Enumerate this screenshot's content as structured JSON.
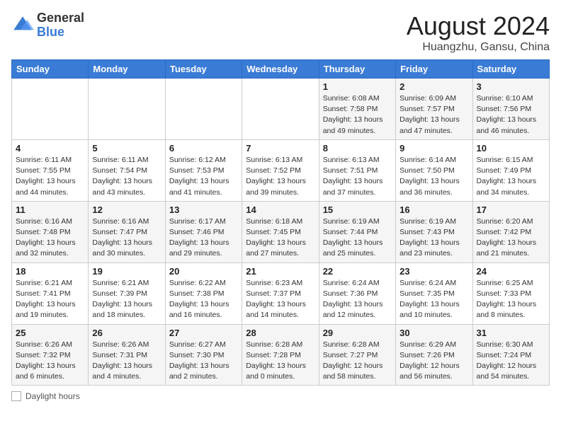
{
  "logo": {
    "general": "General",
    "blue": "Blue"
  },
  "title": {
    "month_year": "August 2024",
    "location": "Huangzhu, Gansu, China"
  },
  "weekdays": [
    "Sunday",
    "Monday",
    "Tuesday",
    "Wednesday",
    "Thursday",
    "Friday",
    "Saturday"
  ],
  "weeks": [
    [
      {
        "day": "",
        "info": ""
      },
      {
        "day": "",
        "info": ""
      },
      {
        "day": "",
        "info": ""
      },
      {
        "day": "",
        "info": ""
      },
      {
        "day": "1",
        "sunrise": "6:08 AM",
        "sunset": "7:58 PM",
        "daylight": "13 hours and 49 minutes."
      },
      {
        "day": "2",
        "sunrise": "6:09 AM",
        "sunset": "7:57 PM",
        "daylight": "13 hours and 47 minutes."
      },
      {
        "day": "3",
        "sunrise": "6:10 AM",
        "sunset": "7:56 PM",
        "daylight": "13 hours and 46 minutes."
      }
    ],
    [
      {
        "day": "4",
        "sunrise": "6:11 AM",
        "sunset": "7:55 PM",
        "daylight": "13 hours and 44 minutes."
      },
      {
        "day": "5",
        "sunrise": "6:11 AM",
        "sunset": "7:54 PM",
        "daylight": "13 hours and 43 minutes."
      },
      {
        "day": "6",
        "sunrise": "6:12 AM",
        "sunset": "7:53 PM",
        "daylight": "13 hours and 41 minutes."
      },
      {
        "day": "7",
        "sunrise": "6:13 AM",
        "sunset": "7:52 PM",
        "daylight": "13 hours and 39 minutes."
      },
      {
        "day": "8",
        "sunrise": "6:13 AM",
        "sunset": "7:51 PM",
        "daylight": "13 hours and 37 minutes."
      },
      {
        "day": "9",
        "sunrise": "6:14 AM",
        "sunset": "7:50 PM",
        "daylight": "13 hours and 36 minutes."
      },
      {
        "day": "10",
        "sunrise": "6:15 AM",
        "sunset": "7:49 PM",
        "daylight": "13 hours and 34 minutes."
      }
    ],
    [
      {
        "day": "11",
        "sunrise": "6:16 AM",
        "sunset": "7:48 PM",
        "daylight": "13 hours and 32 minutes."
      },
      {
        "day": "12",
        "sunrise": "6:16 AM",
        "sunset": "7:47 PM",
        "daylight": "13 hours and 30 minutes."
      },
      {
        "day": "13",
        "sunrise": "6:17 AM",
        "sunset": "7:46 PM",
        "daylight": "13 hours and 29 minutes."
      },
      {
        "day": "14",
        "sunrise": "6:18 AM",
        "sunset": "7:45 PM",
        "daylight": "13 hours and 27 minutes."
      },
      {
        "day": "15",
        "sunrise": "6:19 AM",
        "sunset": "7:44 PM",
        "daylight": "13 hours and 25 minutes."
      },
      {
        "day": "16",
        "sunrise": "6:19 AM",
        "sunset": "7:43 PM",
        "daylight": "13 hours and 23 minutes."
      },
      {
        "day": "17",
        "sunrise": "6:20 AM",
        "sunset": "7:42 PM",
        "daylight": "13 hours and 21 minutes."
      }
    ],
    [
      {
        "day": "18",
        "sunrise": "6:21 AM",
        "sunset": "7:41 PM",
        "daylight": "13 hours and 19 minutes."
      },
      {
        "day": "19",
        "sunrise": "6:21 AM",
        "sunset": "7:39 PM",
        "daylight": "13 hours and 18 minutes."
      },
      {
        "day": "20",
        "sunrise": "6:22 AM",
        "sunset": "7:38 PM",
        "daylight": "13 hours and 16 minutes."
      },
      {
        "day": "21",
        "sunrise": "6:23 AM",
        "sunset": "7:37 PM",
        "daylight": "13 hours and 14 minutes."
      },
      {
        "day": "22",
        "sunrise": "6:24 AM",
        "sunset": "7:36 PM",
        "daylight": "13 hours and 12 minutes."
      },
      {
        "day": "23",
        "sunrise": "6:24 AM",
        "sunset": "7:35 PM",
        "daylight": "13 hours and 10 minutes."
      },
      {
        "day": "24",
        "sunrise": "6:25 AM",
        "sunset": "7:33 PM",
        "daylight": "13 hours and 8 minutes."
      }
    ],
    [
      {
        "day": "25",
        "sunrise": "6:26 AM",
        "sunset": "7:32 PM",
        "daylight": "13 hours and 6 minutes."
      },
      {
        "day": "26",
        "sunrise": "6:26 AM",
        "sunset": "7:31 PM",
        "daylight": "13 hours and 4 minutes."
      },
      {
        "day": "27",
        "sunrise": "6:27 AM",
        "sunset": "7:30 PM",
        "daylight": "13 hours and 2 minutes."
      },
      {
        "day": "28",
        "sunrise": "6:28 AM",
        "sunset": "7:28 PM",
        "daylight": "13 hours and 0 minutes."
      },
      {
        "day": "29",
        "sunrise": "6:28 AM",
        "sunset": "7:27 PM",
        "daylight": "12 hours and 58 minutes."
      },
      {
        "day": "30",
        "sunrise": "6:29 AM",
        "sunset": "7:26 PM",
        "daylight": "12 hours and 56 minutes."
      },
      {
        "day": "31",
        "sunrise": "6:30 AM",
        "sunset": "7:24 PM",
        "daylight": "12 hours and 54 minutes."
      }
    ]
  ],
  "legend": {
    "label": "Daylight hours"
  }
}
